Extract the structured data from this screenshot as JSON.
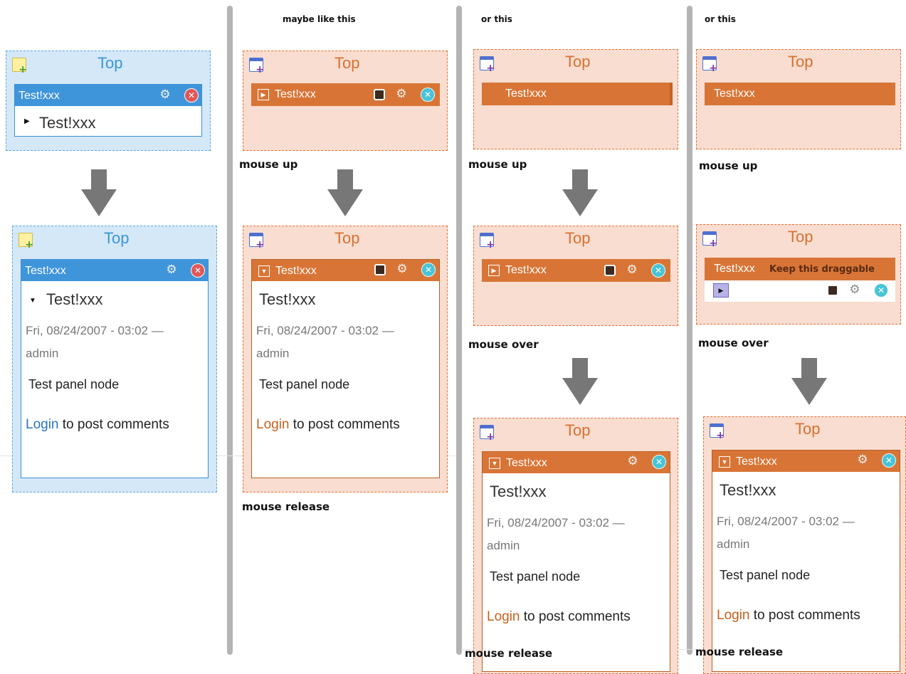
{
  "captions": {
    "col2_header": "maybe like this",
    "col3_header": "or this",
    "col4_header": "or this",
    "mouse_up": "mouse up",
    "mouse_over": "mouse over",
    "mouse_release": "mouse release",
    "keep_draggable": "Keep this draggable"
  },
  "region": {
    "title": "Top"
  },
  "pane": {
    "title": "Test!xxx",
    "node_title": "Test!xxx",
    "date": "Fri, 08/24/2007 - 03:02 —",
    "author": "admin",
    "body": "Test panel node",
    "login_link": "Login",
    "login_rest": " to post comments"
  },
  "icons": {
    "add": "add-content-icon",
    "gear": "gear-icon",
    "close": "close-icon",
    "cache": "cache-icon",
    "toggle": "toggle-icon",
    "arrow": "down-arrow-icon"
  },
  "colors": {
    "blue_theme": "#3f95da",
    "orange_theme": "#d87536",
    "separator": "#b4b4b4"
  }
}
